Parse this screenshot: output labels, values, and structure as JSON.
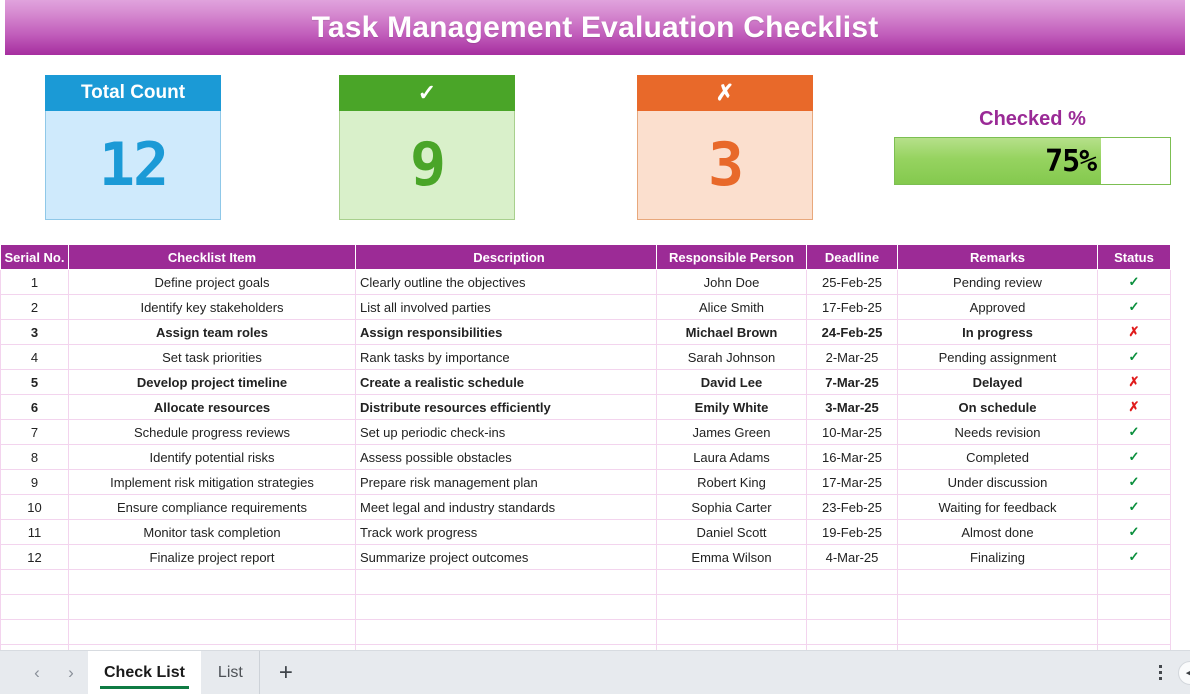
{
  "title": "Task Management Evaluation Checklist",
  "kpis": [
    {
      "name": "total-count",
      "label": "Total Count",
      "value": "12"
    },
    {
      "name": "checked-count",
      "label": "✓",
      "value": "9"
    },
    {
      "name": "unchecked-count",
      "label": "✗",
      "value": "3"
    }
  ],
  "checked_percent": {
    "label": "Checked %",
    "value": "75%",
    "percent": 75
  },
  "colors": {
    "title_gradient_top": "#e0a3dd",
    "title_gradient_bottom": "#a62e9f",
    "header_purple": "#9c2b96",
    "blue": "#1b9ad6",
    "blue_light": "#cfeafc",
    "green": "#4aa528",
    "green_light": "#d9f0ca",
    "orange": "#e8692a",
    "orange_light": "#fbdfce",
    "flag_red": "#e8131b",
    "tick_green": "#0a8f3c",
    "cross_red": "#e01b1b",
    "gridline_pink": "#f3d4ee"
  },
  "table": {
    "columns": [
      "Serial No.",
      "Checklist Item",
      "Description",
      "Responsible Person",
      "Deadline",
      "Remarks",
      "Status"
    ],
    "rows": [
      {
        "serial": "1",
        "item": "Define project goals",
        "description": "Clearly outline the objectives",
        "person": "John Doe",
        "deadline": "25-Feb-25",
        "remarks": "Pending review",
        "status": "✓",
        "flagged": false
      },
      {
        "serial": "2",
        "item": "Identify key stakeholders",
        "description": "List all involved parties",
        "person": "Alice Smith",
        "deadline": "17-Feb-25",
        "remarks": "Approved",
        "status": "✓",
        "flagged": false
      },
      {
        "serial": "3",
        "item": "Assign team roles",
        "description": "Assign responsibilities",
        "person": "Michael Brown",
        "deadline": "24-Feb-25",
        "remarks": "In progress",
        "status": "✗",
        "flagged": true
      },
      {
        "serial": "4",
        "item": "Set task priorities",
        "description": "Rank tasks by importance",
        "person": "Sarah Johnson",
        "deadline": "2-Mar-25",
        "remarks": "Pending assignment",
        "status": "✓",
        "flagged": false
      },
      {
        "serial": "5",
        "item": "Develop project timeline",
        "description": "Create a realistic schedule",
        "person": "David Lee",
        "deadline": "7-Mar-25",
        "remarks": "Delayed",
        "status": "✗",
        "flagged": true
      },
      {
        "serial": "6",
        "item": "Allocate resources",
        "description": "Distribute resources efficiently",
        "person": "Emily White",
        "deadline": "3-Mar-25",
        "remarks": "On schedule",
        "status": "✗",
        "flagged": true
      },
      {
        "serial": "7",
        "item": "Schedule progress reviews",
        "description": "Set up periodic check-ins",
        "person": "James Green",
        "deadline": "10-Mar-25",
        "remarks": "Needs revision",
        "status": "✓",
        "flagged": false
      },
      {
        "serial": "8",
        "item": "Identify potential risks",
        "description": "Assess possible obstacles",
        "person": "Laura Adams",
        "deadline": "16-Mar-25",
        "remarks": "Completed",
        "status": "✓",
        "flagged": false
      },
      {
        "serial": "9",
        "item": "Implement risk mitigation strategies",
        "description": "Prepare risk management plan",
        "person": "Robert King",
        "deadline": "17-Mar-25",
        "remarks": "Under discussion",
        "status": "✓",
        "flagged": false
      },
      {
        "serial": "10",
        "item": "Ensure compliance requirements",
        "description": "Meet legal and industry standards",
        "person": "Sophia Carter",
        "deadline": "23-Feb-25",
        "remarks": "Waiting for feedback",
        "status": "✓",
        "flagged": false
      },
      {
        "serial": "11",
        "item": "Monitor task completion",
        "description": "Track work progress",
        "person": "Daniel Scott",
        "deadline": "19-Feb-25",
        "remarks": "Almost done",
        "status": "✓",
        "flagged": false
      },
      {
        "serial": "12",
        "item": "Finalize project report",
        "description": "Summarize project outcomes",
        "person": "Emma Wilson",
        "deadline": "4-Mar-25",
        "remarks": "Finalizing",
        "status": "✓",
        "flagged": false
      }
    ],
    "empty_row_count": 4
  },
  "tab_bar": {
    "prev_label": "‹",
    "next_label": "›",
    "sheets": [
      {
        "label": "Check List",
        "active": true
      },
      {
        "label": "List",
        "active": false
      }
    ],
    "add_label": "+",
    "menu_label": "more-options",
    "scroll_label": "◀"
  }
}
